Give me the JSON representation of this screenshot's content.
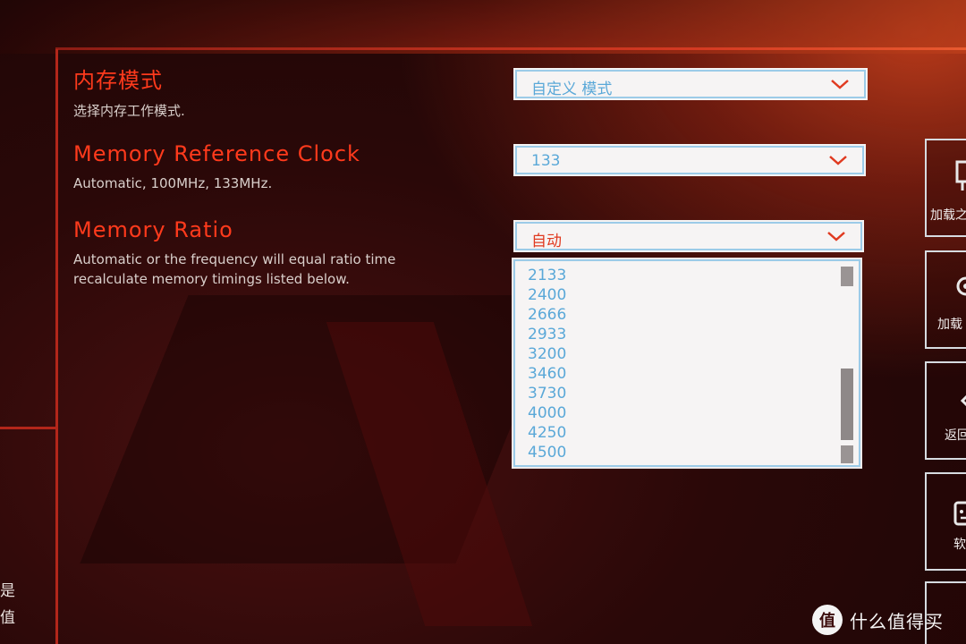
{
  "left_panel": {
    "fragment_1": "是",
    "fragment_2": "值"
  },
  "settings": [
    {
      "title": "内存模式",
      "description": "选择内存工作模式.",
      "selected_value": "自定义 模式"
    },
    {
      "title": "Memory Reference Clock",
      "description": "Automatic, 100MHz, 133MHz.",
      "selected_value": "133"
    },
    {
      "title": "Memory Ratio",
      "description_line1": "Automatic or the frequency will equal ratio time",
      "description_line2": "recalculate memory timings listed below.",
      "selected_value": "自动"
    }
  ],
  "ratio_dropdown": {
    "options": [
      "2133",
      "2400",
      "2666",
      "2933",
      "3200",
      "3460",
      "3730",
      "4000",
      "4250",
      "4500"
    ]
  },
  "side_buttons": [
    {
      "label": "加载之",
      "icon": "load-profile-icon"
    },
    {
      "label": "加载",
      "icon": "load-icon"
    },
    {
      "label": "返回",
      "icon": "back-icon"
    },
    {
      "label": "软",
      "icon": "software-icon"
    },
    {
      "label": "",
      "icon": "unknown-icon"
    }
  ],
  "watermark": {
    "logo_char": "值",
    "text": "什么值得买"
  },
  "colors": {
    "accent_red": "#ff3a1c",
    "select_text_blue": "#5aa8d8",
    "border_blue": "#9ccbe8"
  }
}
